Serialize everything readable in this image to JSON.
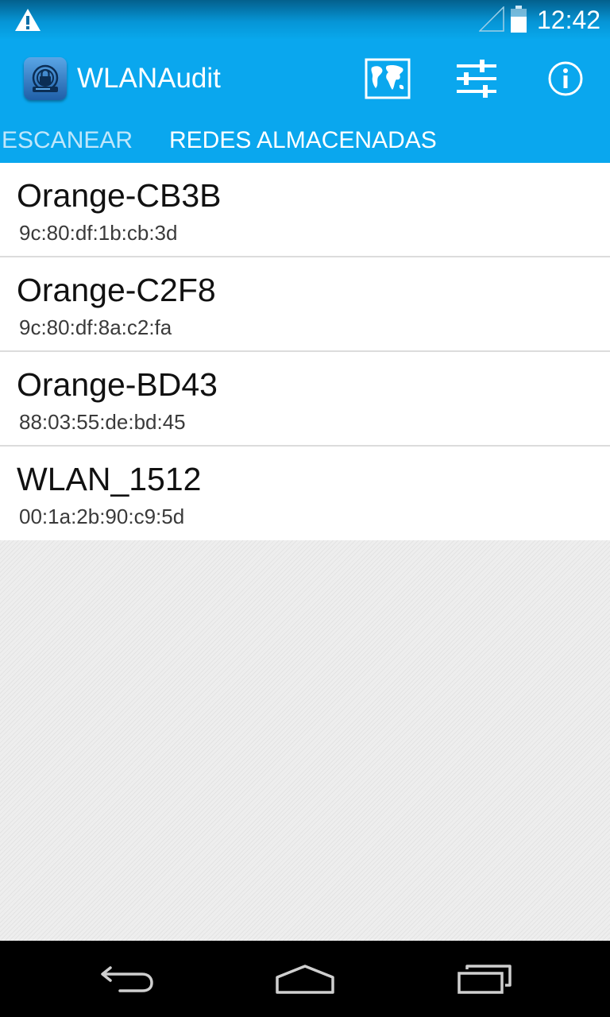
{
  "status_bar": {
    "time": "12:42",
    "icons": [
      "warning-icon",
      "signal-icon",
      "battery-icon"
    ]
  },
  "action_bar": {
    "app_icon": "router-lock-icon",
    "title": "WLANAudit",
    "actions": [
      {
        "name": "map",
        "icon": "world-map-icon"
      },
      {
        "name": "settings",
        "icon": "sliders-icon"
      },
      {
        "name": "info",
        "icon": "info-icon"
      }
    ]
  },
  "tabs": [
    {
      "label": "ESCANEAR",
      "selected": false
    },
    {
      "label": "REDES ALMACENADAS",
      "selected": true
    }
  ],
  "networks": [
    {
      "name": "Orange-CB3B",
      "mac": "9c:80:df:1b:cb:3d"
    },
    {
      "name": "Orange-C2F8",
      "mac": "9c:80:df:8a:c2:fa"
    },
    {
      "name": "Orange-BD43",
      "mac": "88:03:55:de:bd:45"
    },
    {
      "name": "WLAN_1512",
      "mac": "00:1a:2b:90:c9:5d"
    }
  ],
  "nav_bar": {
    "buttons": [
      {
        "name": "back",
        "icon": "back-arrow-icon"
      },
      {
        "name": "home",
        "icon": "home-icon"
      },
      {
        "name": "recents",
        "icon": "recent-apps-icon"
      }
    ]
  },
  "colors": {
    "accent": "#0aa7ee",
    "tab_inactive": "#bfe7fb",
    "divider": "#dcdcdc",
    "nav_bar": "#000000"
  }
}
